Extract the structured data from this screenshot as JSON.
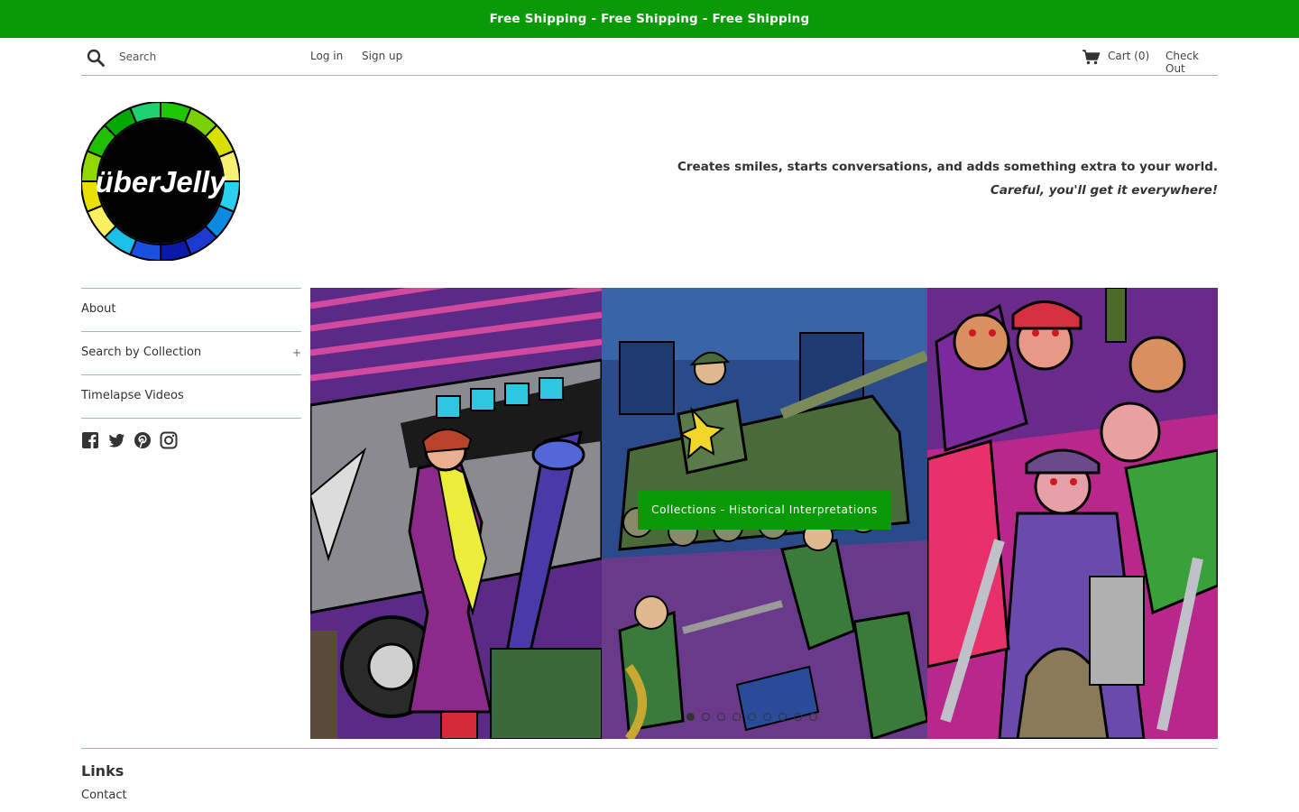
{
  "announcement": "Free Shipping - Free Shipping - Free Shipping",
  "header": {
    "search_placeholder": "Search",
    "login": "Log in",
    "signup": "Sign up",
    "cart": "Cart (0)",
    "checkout": "Check Out"
  },
  "logo": {
    "text": "überJelly"
  },
  "tagline": {
    "line1": "Creates smiles, starts conversations, and adds something extra to your world.",
    "line2": "Careful, you'll get it everywhere!"
  },
  "sidebar": {
    "items": [
      {
        "label": "About"
      },
      {
        "label": "Search by Collection",
        "expand": "+"
      },
      {
        "label": "Timelapse Videos"
      }
    ],
    "social": [
      "facebook-icon",
      "twitter-icon",
      "pinterest-icon",
      "instagram-icon"
    ]
  },
  "slider": {
    "button_label": "Collections - Historical Interpretations",
    "dot_count": 9,
    "active_dot": 0
  },
  "footer": {
    "heading": "Links",
    "links": [
      "Contact"
    ]
  },
  "colors": {
    "brand_green": "#0a9a08",
    "divider_blue": "#7cc6dc"
  }
}
